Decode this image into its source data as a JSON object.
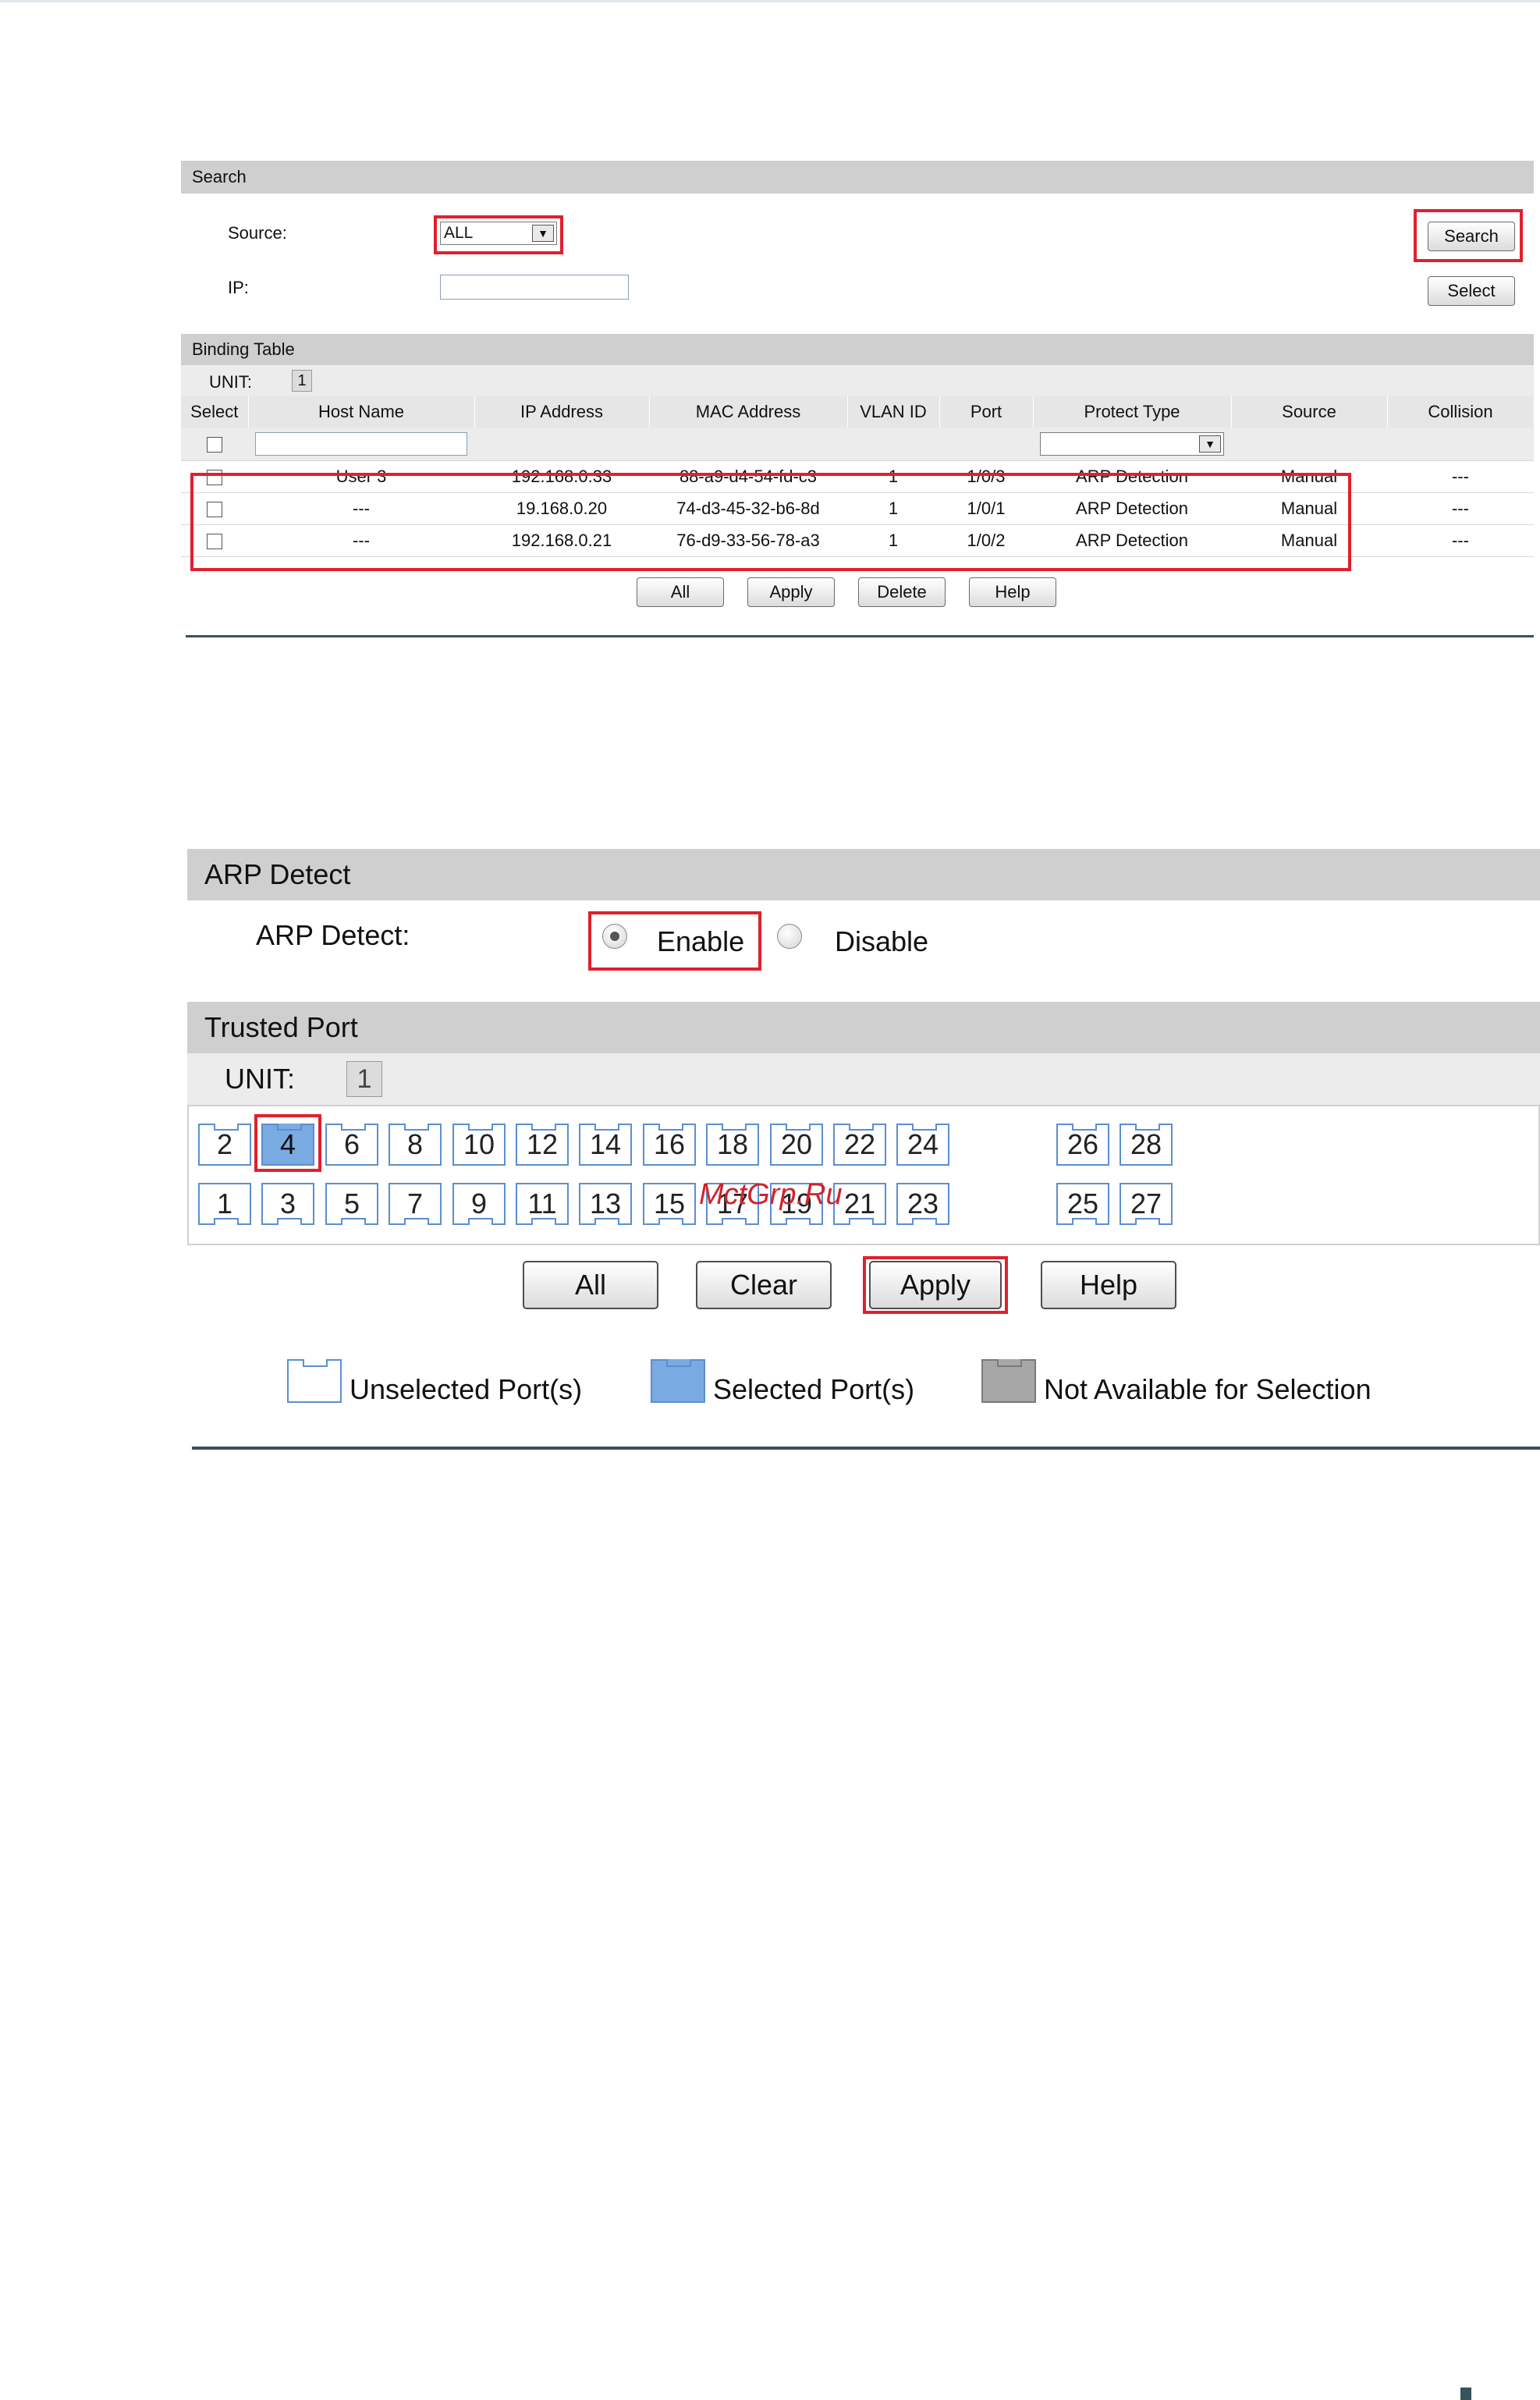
{
  "search": {
    "section_title": "Search",
    "source_label": "Source:",
    "source_value": "ALL",
    "ip_label": "IP:",
    "ip_value": "",
    "search_button": "Search",
    "select_button": "Select"
  },
  "binding": {
    "section_title": "Binding Table",
    "unit_label": "UNIT:",
    "unit_value": "1",
    "columns": [
      "Select",
      "Host Name",
      "IP Address",
      "MAC Address",
      "VLAN ID",
      "Port",
      "Protect Type",
      "Source",
      "Collision"
    ],
    "rows": [
      {
        "host": "User 3",
        "ip": "192.168.0.33",
        "mac": "88-a9-d4-54-fd-c3",
        "vlan": "1",
        "port": "1/0/3",
        "protect": "ARP Detection",
        "source": "Manual",
        "collision": "---"
      },
      {
        "host": "---",
        "ip": "19.168.0.20",
        "mac": "74-d3-45-32-b6-8d",
        "vlan": "1",
        "port": "1/0/1",
        "protect": "ARP Detection",
        "source": "Manual",
        "collision": "---"
      },
      {
        "host": "---",
        "ip": "192.168.0.21",
        "mac": "76-d9-33-56-78-a3",
        "vlan": "1",
        "port": "1/0/2",
        "protect": "ARP Detection",
        "source": "Manual",
        "collision": "---"
      }
    ],
    "buttons": {
      "all": "All",
      "apply": "Apply",
      "delete": "Delete",
      "help": "Help"
    }
  },
  "arp": {
    "section_title": "ARP Detect",
    "label": "ARP Detect:",
    "enable_label": "Enable",
    "disable_label": "Disable",
    "selected": "Enable"
  },
  "trusted": {
    "section_title": "Trusted Port",
    "unit_label": "UNIT:",
    "unit_value": "1",
    "top_ports": [
      "2",
      "4",
      "6",
      "8",
      "10",
      "12",
      "14",
      "16",
      "18",
      "20",
      "22",
      "24",
      "26",
      "28"
    ],
    "bottom_ports": [
      "1",
      "3",
      "5",
      "7",
      "9",
      "11",
      "13",
      "15",
      "17",
      "19",
      "21",
      "23",
      "25",
      "27"
    ],
    "selected_ports": [
      "4"
    ],
    "buttons": {
      "all": "All",
      "clear": "Clear",
      "apply": "Apply",
      "help": "Help"
    },
    "legend": {
      "unselected": "Unselected Port(s)",
      "selected": "Selected Port(s)",
      "na": "Not Available for Selection"
    }
  },
  "watermark": "MctGrp.Ru",
  "colors": {
    "highlight": "#e0202e",
    "selected_port": "#7aaae2",
    "port_border": "#5b8fcf",
    "section_bar": "#cfcfcf",
    "rule": "#38525e"
  }
}
